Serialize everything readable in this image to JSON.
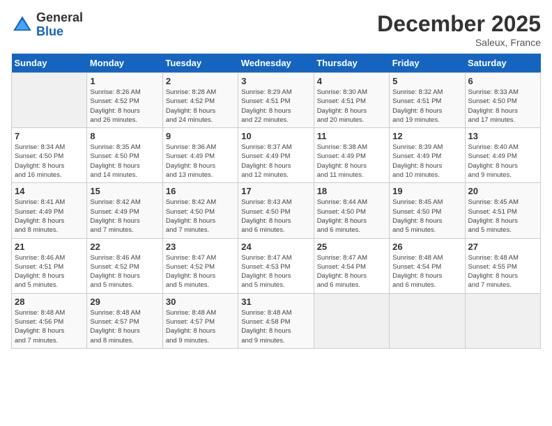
{
  "logo": {
    "general": "General",
    "blue": "Blue"
  },
  "header": {
    "month": "December 2025",
    "location": "Saleux, France"
  },
  "weekdays": [
    "Sunday",
    "Monday",
    "Tuesday",
    "Wednesday",
    "Thursday",
    "Friday",
    "Saturday"
  ],
  "weeks": [
    [
      {
        "day": "",
        "info": ""
      },
      {
        "day": "1",
        "info": "Sunrise: 8:26 AM\nSunset: 4:52 PM\nDaylight: 8 hours\nand 26 minutes."
      },
      {
        "day": "2",
        "info": "Sunrise: 8:28 AM\nSunset: 4:52 PM\nDaylight: 8 hours\nand 24 minutes."
      },
      {
        "day": "3",
        "info": "Sunrise: 8:29 AM\nSunset: 4:51 PM\nDaylight: 8 hours\nand 22 minutes."
      },
      {
        "day": "4",
        "info": "Sunrise: 8:30 AM\nSunset: 4:51 PM\nDaylight: 8 hours\nand 20 minutes."
      },
      {
        "day": "5",
        "info": "Sunrise: 8:32 AM\nSunset: 4:51 PM\nDaylight: 8 hours\nand 19 minutes."
      },
      {
        "day": "6",
        "info": "Sunrise: 8:33 AM\nSunset: 4:50 PM\nDaylight: 8 hours\nand 17 minutes."
      }
    ],
    [
      {
        "day": "7",
        "info": "Sunrise: 8:34 AM\nSunset: 4:50 PM\nDaylight: 8 hours\nand 16 minutes."
      },
      {
        "day": "8",
        "info": "Sunrise: 8:35 AM\nSunset: 4:50 PM\nDaylight: 8 hours\nand 14 minutes."
      },
      {
        "day": "9",
        "info": "Sunrise: 8:36 AM\nSunset: 4:49 PM\nDaylight: 8 hours\nand 13 minutes."
      },
      {
        "day": "10",
        "info": "Sunrise: 8:37 AM\nSunset: 4:49 PM\nDaylight: 8 hours\nand 12 minutes."
      },
      {
        "day": "11",
        "info": "Sunrise: 8:38 AM\nSunset: 4:49 PM\nDaylight: 8 hours\nand 11 minutes."
      },
      {
        "day": "12",
        "info": "Sunrise: 8:39 AM\nSunset: 4:49 PM\nDaylight: 8 hours\nand 10 minutes."
      },
      {
        "day": "13",
        "info": "Sunrise: 8:40 AM\nSunset: 4:49 PM\nDaylight: 8 hours\nand 9 minutes."
      }
    ],
    [
      {
        "day": "14",
        "info": "Sunrise: 8:41 AM\nSunset: 4:49 PM\nDaylight: 8 hours\nand 8 minutes."
      },
      {
        "day": "15",
        "info": "Sunrise: 8:42 AM\nSunset: 4:49 PM\nDaylight: 8 hours\nand 7 minutes."
      },
      {
        "day": "16",
        "info": "Sunrise: 8:42 AM\nSunset: 4:50 PM\nDaylight: 8 hours\nand 7 minutes."
      },
      {
        "day": "17",
        "info": "Sunrise: 8:43 AM\nSunset: 4:50 PM\nDaylight: 8 hours\nand 6 minutes."
      },
      {
        "day": "18",
        "info": "Sunrise: 8:44 AM\nSunset: 4:50 PM\nDaylight: 8 hours\nand 6 minutes."
      },
      {
        "day": "19",
        "info": "Sunrise: 8:45 AM\nSunset: 4:50 PM\nDaylight: 8 hours\nand 5 minutes."
      },
      {
        "day": "20",
        "info": "Sunrise: 8:45 AM\nSunset: 4:51 PM\nDaylight: 8 hours\nand 5 minutes."
      }
    ],
    [
      {
        "day": "21",
        "info": "Sunrise: 8:46 AM\nSunset: 4:51 PM\nDaylight: 8 hours\nand 5 minutes."
      },
      {
        "day": "22",
        "info": "Sunrise: 8:46 AM\nSunset: 4:52 PM\nDaylight: 8 hours\nand 5 minutes."
      },
      {
        "day": "23",
        "info": "Sunrise: 8:47 AM\nSunset: 4:52 PM\nDaylight: 8 hours\nand 5 minutes."
      },
      {
        "day": "24",
        "info": "Sunrise: 8:47 AM\nSunset: 4:53 PM\nDaylight: 8 hours\nand 5 minutes."
      },
      {
        "day": "25",
        "info": "Sunrise: 8:47 AM\nSunset: 4:54 PM\nDaylight: 8 hours\nand 6 minutes."
      },
      {
        "day": "26",
        "info": "Sunrise: 8:48 AM\nSunset: 4:54 PM\nDaylight: 8 hours\nand 6 minutes."
      },
      {
        "day": "27",
        "info": "Sunrise: 8:48 AM\nSunset: 4:55 PM\nDaylight: 8 hours\nand 7 minutes."
      }
    ],
    [
      {
        "day": "28",
        "info": "Sunrise: 8:48 AM\nSunset: 4:56 PM\nDaylight: 8 hours\nand 7 minutes."
      },
      {
        "day": "29",
        "info": "Sunrise: 8:48 AM\nSunset: 4:57 PM\nDaylight: 8 hours\nand 8 minutes."
      },
      {
        "day": "30",
        "info": "Sunrise: 8:48 AM\nSunset: 4:57 PM\nDaylight: 8 hours\nand 9 minutes."
      },
      {
        "day": "31",
        "info": "Sunrise: 8:48 AM\nSunset: 4:58 PM\nDaylight: 8 hours\nand 9 minutes."
      },
      {
        "day": "",
        "info": ""
      },
      {
        "day": "",
        "info": ""
      },
      {
        "day": "",
        "info": ""
      }
    ]
  ]
}
